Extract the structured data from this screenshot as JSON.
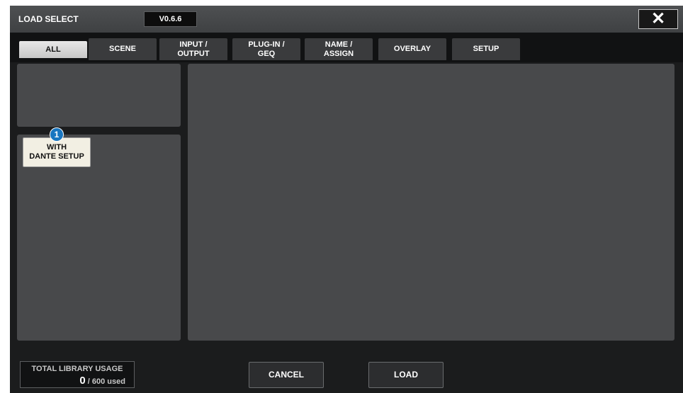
{
  "window": {
    "title": "LOAD SELECT",
    "version": "V0.6.6",
    "close_label": "✕"
  },
  "tabs": [
    {
      "line1": "ALL",
      "line2": "",
      "active": true
    },
    {
      "line1": "SCENE",
      "line2": "",
      "active": false
    },
    {
      "line1": "INPUT /",
      "line2": "OUTPUT",
      "active": false
    },
    {
      "line1": "PLUG-IN /",
      "line2": "GEQ",
      "active": false
    },
    {
      "line1": "NAME /",
      "line2": "ASSIGN",
      "active": false
    },
    {
      "line1": "OVERLAY",
      "line2": "",
      "active": false
    },
    {
      "line1": "SETUP",
      "line2": "",
      "active": false
    }
  ],
  "dante_button": {
    "line1": "WITH",
    "line2": "DANTE SETUP",
    "badge": "1"
  },
  "usage": {
    "label": "TOTAL LIBRARY USAGE",
    "count": "0",
    "suffix": " / 600 used"
  },
  "actions": {
    "cancel_label": "CANCEL",
    "load_label": "LOAD"
  },
  "colors": {
    "background": "#1b1c1d",
    "panel": "#48494b",
    "badge": "#1976c0",
    "active_tab": "#d9d9d9"
  }
}
